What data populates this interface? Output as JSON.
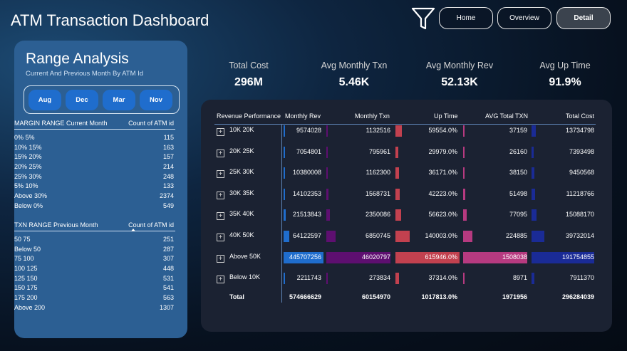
{
  "header": {
    "title": "ATM Transaction Dashboard",
    "nav": [
      {
        "label": "Home"
      },
      {
        "label": "Overview"
      },
      {
        "label": "Detail"
      }
    ]
  },
  "left_panel": {
    "title": "Range Analysis",
    "subtitle": "Current And Previous Month By ATM Id",
    "months": [
      "Aug",
      "Dec",
      "Mar",
      "Nov"
    ],
    "margin_table": {
      "col1": "MARGIN RANGE Current Month",
      "col2": "Count of ATM id",
      "rows": [
        {
          "range": "0% 5%",
          "count": "115"
        },
        {
          "range": "10% 15%",
          "count": "163"
        },
        {
          "range": "15% 20%",
          "count": "157"
        },
        {
          "range": "20% 25%",
          "count": "214"
        },
        {
          "range": "25% 30%",
          "count": "248"
        },
        {
          "range": "5% 10%",
          "count": "133"
        },
        {
          "range": "Above 30%",
          "count": "2374"
        },
        {
          "range": "Below 0%",
          "count": "549"
        }
      ]
    },
    "txn_table": {
      "col1": "TXN RANGE Previous Month",
      "col2": "Count of ATM id",
      "rows": [
        {
          "range": "50 75",
          "count": "251"
        },
        {
          "range": "Below 50",
          "count": "287"
        },
        {
          "range": "75 100",
          "count": "307"
        },
        {
          "range": "100 125",
          "count": "448"
        },
        {
          "range": "125 150",
          "count": "531"
        },
        {
          "range": "150 175",
          "count": "541"
        },
        {
          "range": "175 200",
          "count": "563"
        },
        {
          "range": "Above 200",
          "count": "1307"
        }
      ]
    }
  },
  "kpis": [
    {
      "label": "Total Cost",
      "value": "296M"
    },
    {
      "label": "Avg Monthly Txn",
      "value": "5.46K"
    },
    {
      "label": "Avg Monthly Rev",
      "value": "52.13K"
    },
    {
      "label": "Avg Up Time",
      "value": "91.9%"
    }
  ],
  "table": {
    "headers": [
      "Revenue Performance",
      "Monthly Rev",
      "Monthly Txn",
      "Up Time",
      "AVG Total TXN",
      "Total Cost"
    ],
    "rows": [
      {
        "label": "10K 20K",
        "rev": "9574028",
        "txn": "1132516",
        "up": "59554.0%",
        "avg": "37159",
        "cost": "13734798"
      },
      {
        "label": "20K 25K",
        "rev": "7054801",
        "txn": "795961",
        "up": "29979.0%",
        "avg": "26160",
        "cost": "7393498"
      },
      {
        "label": "25K 30K",
        "rev": "10380008",
        "txn": "1162300",
        "up": "36171.0%",
        "avg": "38150",
        "cost": "9450568"
      },
      {
        "label": "30K 35K",
        "rev": "14102353",
        "txn": "1568731",
        "up": "42223.0%",
        "avg": "51498",
        "cost": "11218766"
      },
      {
        "label": "35K 40K",
        "rev": "21513843",
        "txn": "2350086",
        "up": "56623.0%",
        "avg": "77095",
        "cost": "15088170"
      },
      {
        "label": "40K 50K",
        "rev": "64122597",
        "txn": "6850745",
        "up": "140003.0%",
        "avg": "224885",
        "cost": "39732014"
      },
      {
        "label": "Above 50K",
        "rev": "445707256",
        "txn": "46020797",
        "up": "615946.0%",
        "avg": "1508038",
        "cost": "191754855"
      },
      {
        "label": "Below 10K",
        "rev": "2211743",
        "txn": "273834",
        "up": "37314.0%",
        "avg": "8971",
        "cost": "7911370"
      }
    ],
    "total": {
      "label": "Total",
      "rev": "574666629",
      "txn": "60154970",
      "up": "1017813.0%",
      "avg": "1971956",
      "cost": "296284039"
    },
    "bar_values": {
      "rev": [
        9574028,
        7054801,
        10380008,
        14102353,
        21513843,
        64122597,
        445707256,
        2211743
      ],
      "txn": [
        1132516,
        795961,
        1162300,
        1568731,
        2350086,
        6850745,
        46020797,
        273834
      ],
      "up": [
        59554,
        29979,
        36171,
        42223,
        56623,
        140003,
        615946,
        37314
      ],
      "avg": [
        37159,
        26160,
        38150,
        51498,
        77095,
        224885,
        1508038,
        8971
      ],
      "cost": [
        13734798,
        7393498,
        9450568,
        11218766,
        15088170,
        39732014,
        191754855,
        7911370
      ]
    },
    "bar_colors": {
      "rev": "#1f6dcd",
      "txn": "#5e0f70",
      "up": "#c2414f",
      "avg": "#b63a80",
      "cost": "#1a2b96"
    }
  }
}
